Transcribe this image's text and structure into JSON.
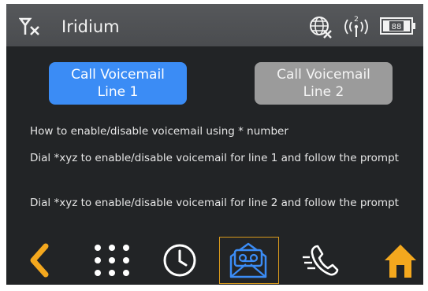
{
  "status_bar": {
    "carrier": "Iridium",
    "signal_icon": "no-signal-icon",
    "globe_icon": "globe-icon",
    "radio_icon": "antenna-wave-icon",
    "radio_level": "2",
    "battery_icon": "battery-icon",
    "battery_level": "88"
  },
  "buttons": {
    "line1": {
      "line_a": "Call Voicemail",
      "line_b": "Line 1",
      "color": "#3b8cf5"
    },
    "line2": {
      "line_a": "Call Voicemail",
      "line_b": "Line 2",
      "color": "#9b9b9b"
    }
  },
  "info": {
    "heading": "How to enable/disable voicemail using * number",
    "line1_instr": "Dial *xyz to enable/disable voicemail for line 1 and follow the prompt",
    "line2_instr": "Dial *xyz to enable/disable voicemail for line 2 and follow the prompt"
  },
  "nav": {
    "items": [
      "back-icon",
      "keypad-icon",
      "clock-icon",
      "voicemail-icon",
      "call-log-icon",
      "home-icon"
    ],
    "selected": "voicemail-icon",
    "accent": "#f4a81e",
    "selected_border": "#d99a1c"
  }
}
